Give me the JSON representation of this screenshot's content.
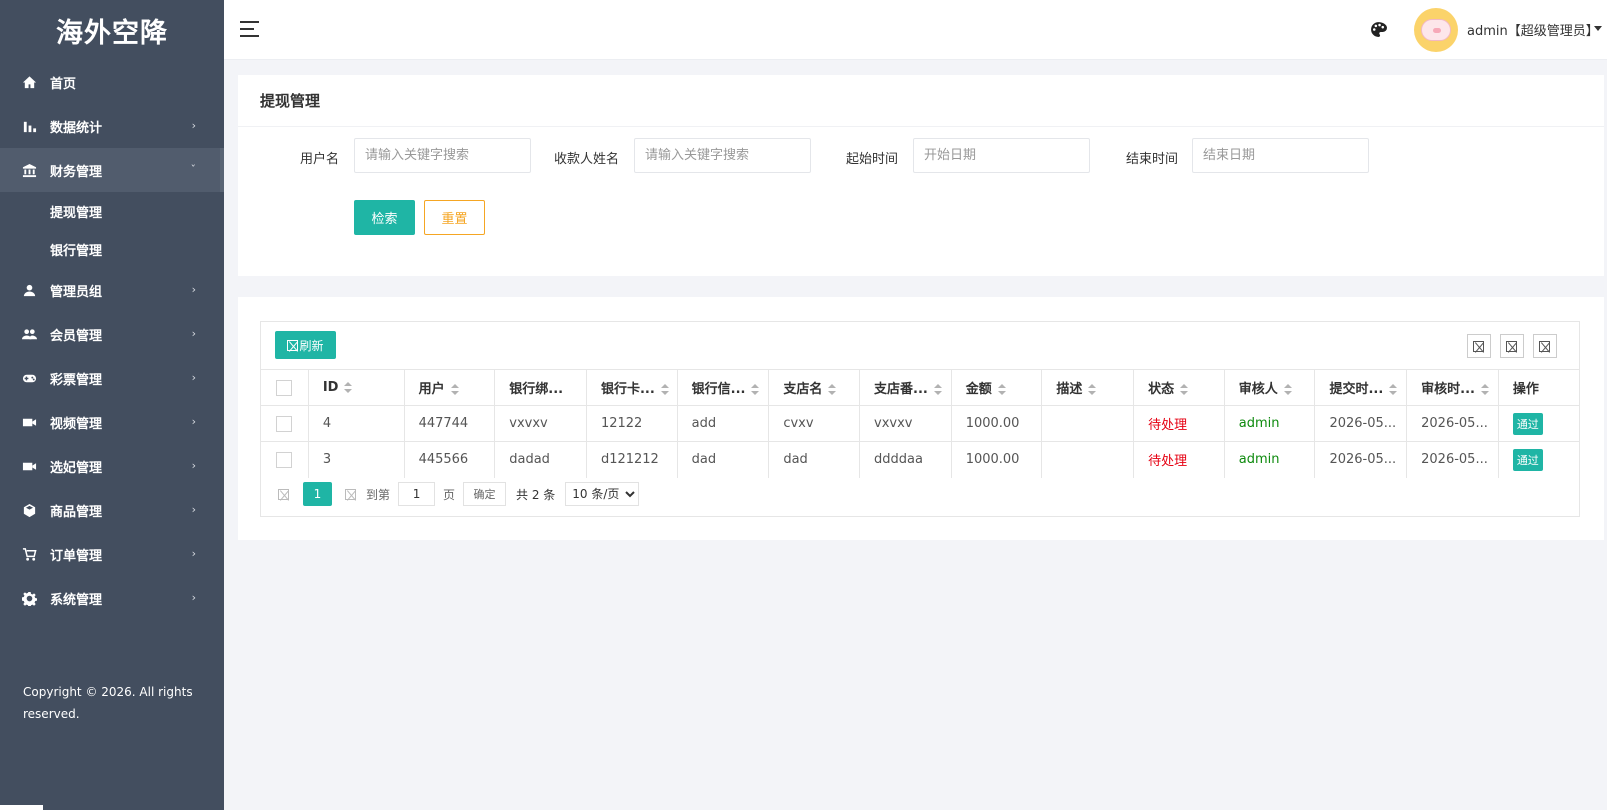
{
  "app": {
    "title": "海外空降"
  },
  "sidebar": {
    "items": [
      {
        "label": "首页",
        "icon": "home-icon",
        "chevron": ""
      },
      {
        "label": "数据统计",
        "icon": "bar-chart-icon",
        "chevron": "›"
      },
      {
        "label": "财务管理",
        "icon": "bank-icon",
        "chevron": "ˇ",
        "expanded": true
      },
      {
        "label": "管理员组",
        "icon": "person-icon",
        "chevron": "›"
      },
      {
        "label": "会员管理",
        "icon": "people-icon",
        "chevron": "›"
      },
      {
        "label": "彩票管理",
        "icon": "gamepad-icon",
        "chevron": "›"
      },
      {
        "label": "视频管理",
        "icon": "videocam-icon",
        "chevron": "›"
      },
      {
        "label": "选妃管理",
        "icon": "videocam-icon",
        "chevron": "›"
      },
      {
        "label": "商品管理",
        "icon": "cube-icon",
        "chevron": "›"
      },
      {
        "label": "订单管理",
        "icon": "cart-icon",
        "chevron": "›"
      },
      {
        "label": "系统管理",
        "icon": "gear-icon",
        "chevron": "›"
      }
    ],
    "sub_items": [
      "提现管理",
      "银行管理"
    ],
    "copyright": "Copyright © 2026. All rights reserved."
  },
  "header": {
    "user": "admin【超级管理员】"
  },
  "filter": {
    "title": "提现管理",
    "fields": [
      {
        "label": "用户名",
        "placeholder": "请输入关键字搜索"
      },
      {
        "label": "收款人姓名",
        "placeholder": "请输入关键字搜索"
      },
      {
        "label": "起始时间",
        "placeholder": "开始日期"
      },
      {
        "label": "结束时间",
        "placeholder": "结束日期"
      }
    ],
    "search_label": "检索",
    "reset_label": "重置"
  },
  "table": {
    "refresh_label": "刷新",
    "columns": [
      "ID",
      "用户",
      "银行绑...",
      "银行卡...",
      "银行信...",
      "支店名",
      "支店番...",
      "金额",
      "描述",
      "状态",
      "审核人",
      "提交时...",
      "审核时...",
      "操作"
    ],
    "rows": [
      {
        "id": "4",
        "user": "447744",
        "bank_bind": "vxvxv",
        "card": "12122",
        "bank_info": "add",
        "branch": "cvxv",
        "branch_no": "vxvxv",
        "amount": "1000.00",
        "desc": "",
        "status": "待处理",
        "reviewer": "admin",
        "submit_time": "2026-05...",
        "review_time": "2026-05...",
        "action": "通过"
      },
      {
        "id": "3",
        "user": "445566",
        "bank_bind": "dadad",
        "card": "d121212",
        "bank_info": "dad",
        "branch": "dad",
        "branch_no": "ddddaa",
        "amount": "1000.00",
        "desc": "",
        "status": "待处理",
        "reviewer": "admin",
        "submit_time": "2026-05...",
        "review_time": "2026-05...",
        "action": "通过"
      }
    ],
    "colors": {
      "accent": "#1fb5a5",
      "pending": "#e60012",
      "reviewer": "#0e8a0e",
      "warning": "#f5a623"
    }
  },
  "pagination": {
    "current_page": "1",
    "goto_label": "到第",
    "page_input": "1",
    "page_unit": "页",
    "confirm_label": "确定",
    "total_label": "共 2 条",
    "per_page": "10 条/页"
  }
}
